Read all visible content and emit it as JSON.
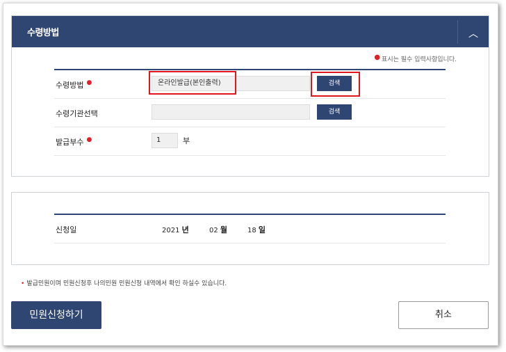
{
  "section": {
    "title": "수령방법",
    "collapse_icon": "chevron-up-icon",
    "required_note": "표시는 필수 입력사항입니다."
  },
  "form": {
    "receive_method": {
      "label": "수령방법",
      "required": true,
      "value": "온라인발급(본인출력)",
      "button": "검색"
    },
    "receive_agency": {
      "label": "수령기관선택",
      "value": "",
      "button": "검색"
    },
    "copies": {
      "label": "발급부수",
      "required": true,
      "value": "1",
      "unit": "부"
    }
  },
  "apply_date": {
    "label": "신청일",
    "year": "2021",
    "year_unit": "년",
    "month": "02",
    "month_unit": "월",
    "day": "18",
    "day_unit": "일"
  },
  "notice": "발급민원이며 민원신청후 나의민원 민원신청 내역에서 확인 하실수 있습니다.",
  "actions": {
    "apply": "민원신청하기",
    "cancel": "취소"
  },
  "colors": {
    "primary": "#2f4673",
    "required": "#e0202a",
    "highlight": "#e0151d"
  }
}
